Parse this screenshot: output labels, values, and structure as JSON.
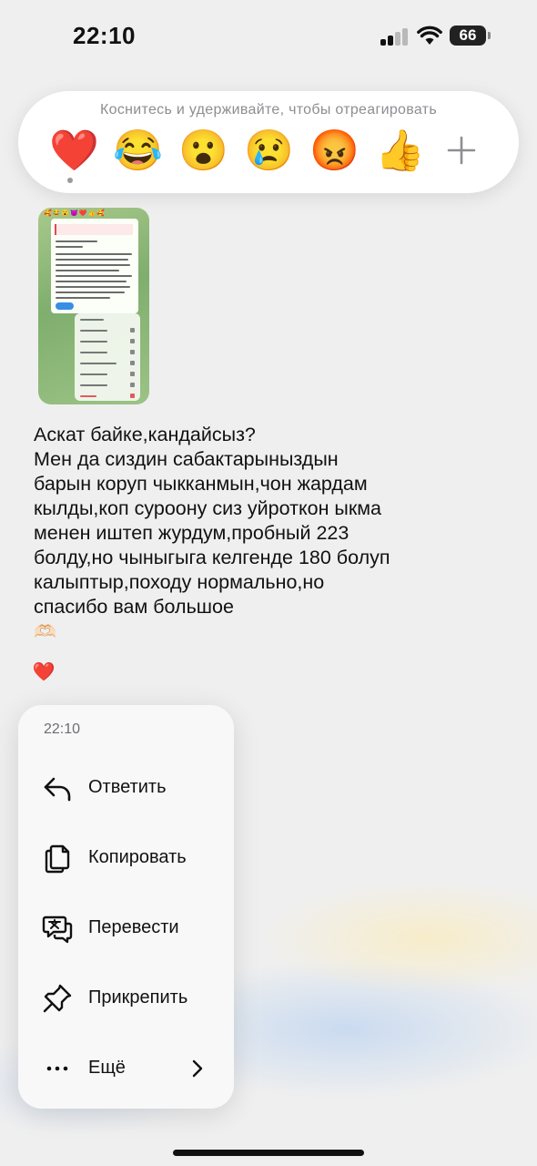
{
  "status_bar": {
    "time": "22:10",
    "battery": "66"
  },
  "reactions": {
    "hint": "Коснитесь и удерживайте, чтобы отреагировать",
    "emojis": [
      "❤️",
      "😂",
      "😮",
      "😢",
      "😡",
      "👍"
    ]
  },
  "message": {
    "text": "Аскат байке,кандайсыз?\nМен да сиздин сабактарыныздын барын коруп чыкканмын,чон жардам кылды,коп суроону сиз уйроткон ыкма менен иштеп журдум,пробный 223 болду,но чыныгыга келгенде 180 болуп калыптыр,походу нормально,но спасибо вам большое",
    "hands_emoji": "🫶🏻",
    "reaction": "❤️"
  },
  "context_menu": {
    "time": "22:10",
    "items": [
      {
        "label": "Ответить",
        "icon": "reply-icon"
      },
      {
        "label": "Копировать",
        "icon": "copy-icon"
      },
      {
        "label": "Перевести",
        "icon": "translate-icon"
      },
      {
        "label": "Прикрепить",
        "icon": "pin-icon"
      },
      {
        "label": "Ещё",
        "icon": "more-icon"
      }
    ]
  }
}
